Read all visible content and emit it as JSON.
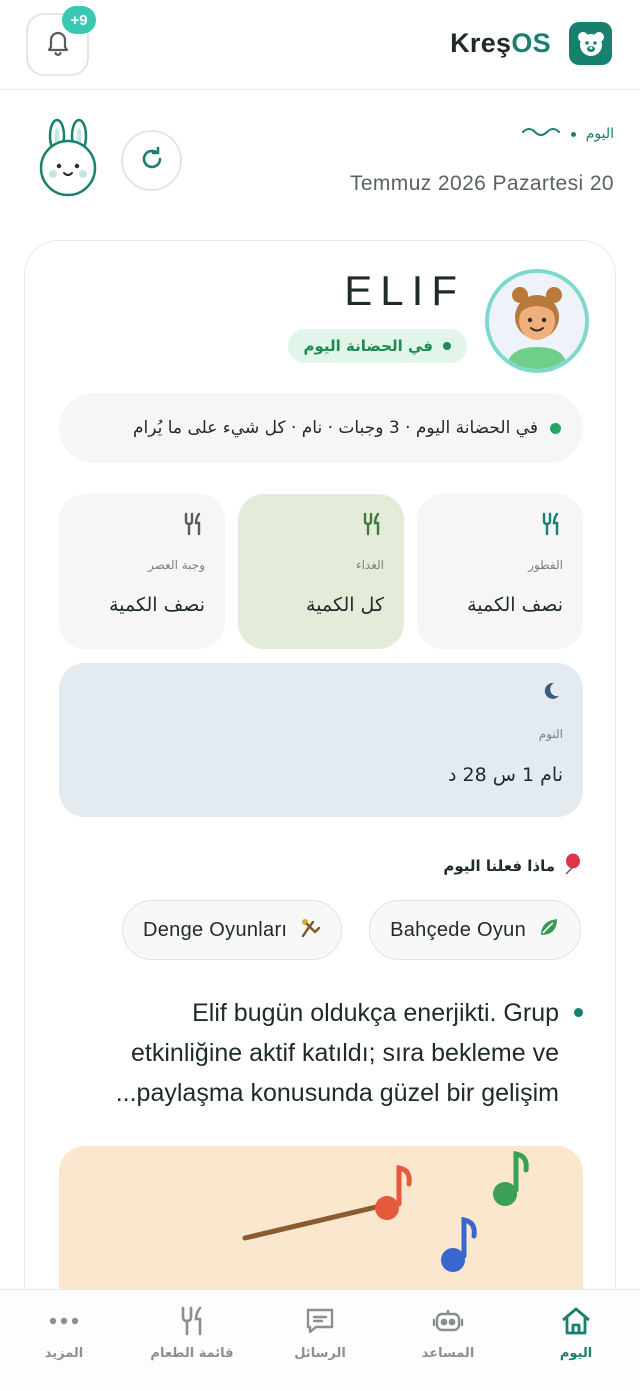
{
  "topbar": {
    "notification_badge": "+9",
    "brand_prefix": "Kreş",
    "brand_suffix": "OS"
  },
  "header": {
    "today_label": "اليوم",
    "date": "Temmuz 2026 Pazartesi 20"
  },
  "child": {
    "name": "ELIF",
    "status": "في الحضانة اليوم",
    "summary": "في الحضانة اليوم · 3 وجبات · نام · كل شيء على ما يُرام",
    "meals": [
      {
        "label": "الفطور",
        "value": "نصف الكمية",
        "active": false
      },
      {
        "label": "الغداء",
        "value": "كل الكمية",
        "active": true
      },
      {
        "label": "وجبة العصر",
        "value": "نصف الكمية",
        "active": false
      }
    ],
    "sleep": {
      "label": "النوم",
      "value": "نام 1 س 28 د"
    },
    "activities_title": "ماذا فعلنا اليوم",
    "activities": [
      "Bahçede Oyun",
      "Denge Oyunları"
    ],
    "note": "Elif bugün oldukça enerjikti. Grup etkinliğine aktif katıldı; sıra bekleme ve paylaşma konusunda güzel bir gelişim..."
  },
  "nav": [
    {
      "label": "اليوم",
      "icon": "home-icon",
      "active": true
    },
    {
      "label": "المساعد",
      "icon": "robot-icon",
      "active": false
    },
    {
      "label": "الرسائل",
      "icon": "message-icon",
      "active": false
    },
    {
      "label": "قائمة الطعام",
      "icon": "fork-knife-icon",
      "active": false
    },
    {
      "label": "المزيد",
      "icon": "more-dots-icon",
      "active": false
    }
  ],
  "colors": {
    "brand": "#17806e",
    "badge": "#38c8b4",
    "status_green": "#1c8a52",
    "lunch_bg": "#e3ecd9",
    "sleep_bg": "#e4ebf0"
  }
}
